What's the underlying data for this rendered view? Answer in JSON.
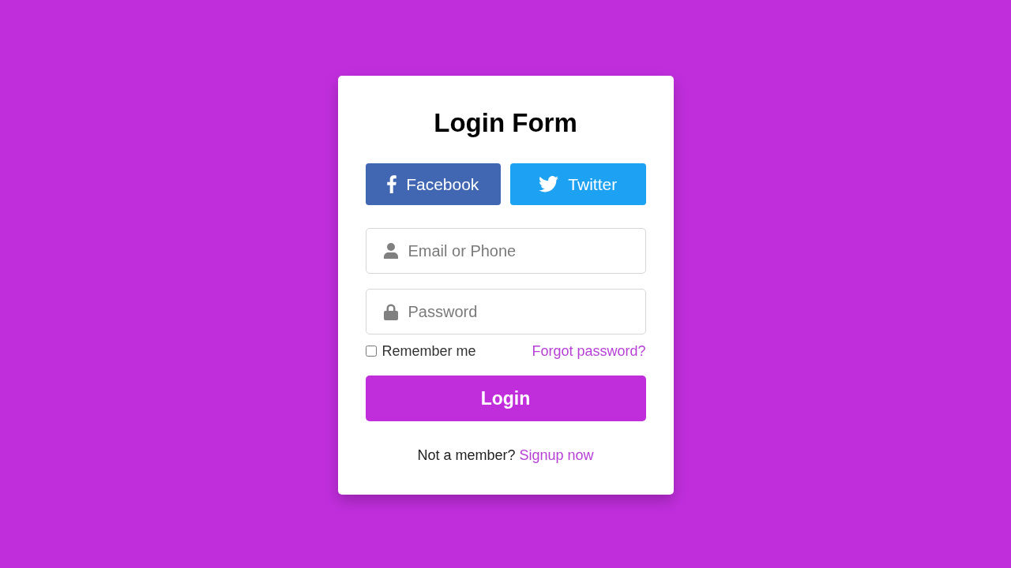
{
  "title": "Login Form",
  "social_buttons": [
    {
      "kind": "facebook",
      "label": "Facebook",
      "color": "#4267b2"
    },
    {
      "kind": "twitter",
      "label": "Twitter",
      "color": "#1da1f2"
    }
  ],
  "fields": [
    {
      "kind": "user",
      "placeholder": "Email or Phone"
    },
    {
      "kind": "lock",
      "placeholder": "Password"
    }
  ],
  "remember": {
    "label": "Remember me",
    "checked": false
  },
  "forgot_link": "Forgot password?",
  "login_button": "Login",
  "signup": {
    "text": "Not a member?",
    "link": "Signup now"
  }
}
